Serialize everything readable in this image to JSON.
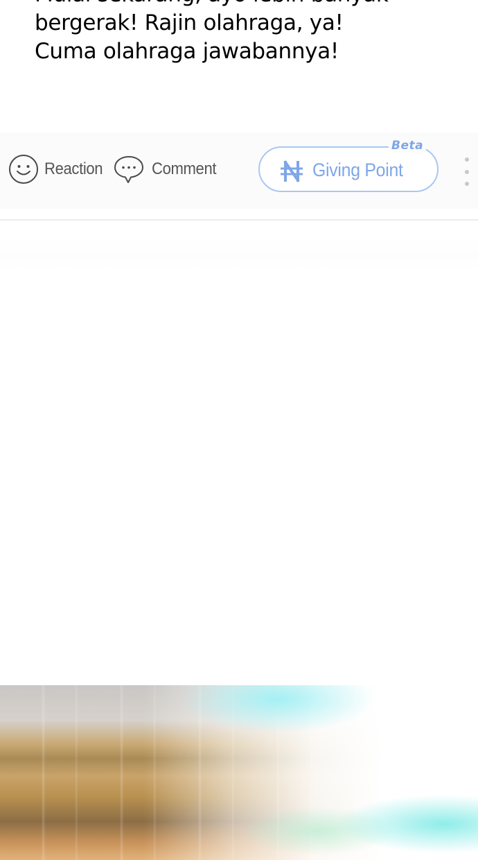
{
  "post": {
    "lines": [
      "Mulai sekarang, ayo lebih banyak",
      "bergerak! Rajin olahraga, ya!",
      "Cuma olahraga jawabannya!"
    ]
  },
  "actions": {
    "reaction_label": "Reaction",
    "reaction_icon": "smiley-icon",
    "comment_label": "Comment",
    "comment_icon": "speech-bubble-icon",
    "giving_point_label": "Giving Point",
    "giving_point_icon": "naira-icon",
    "beta_label": "Beta",
    "more_icon": "more-vertical-icon"
  },
  "colors": {
    "accent": "#7ea6e8",
    "accent_border": "#a9c7f3",
    "label_gray": "#555555"
  }
}
